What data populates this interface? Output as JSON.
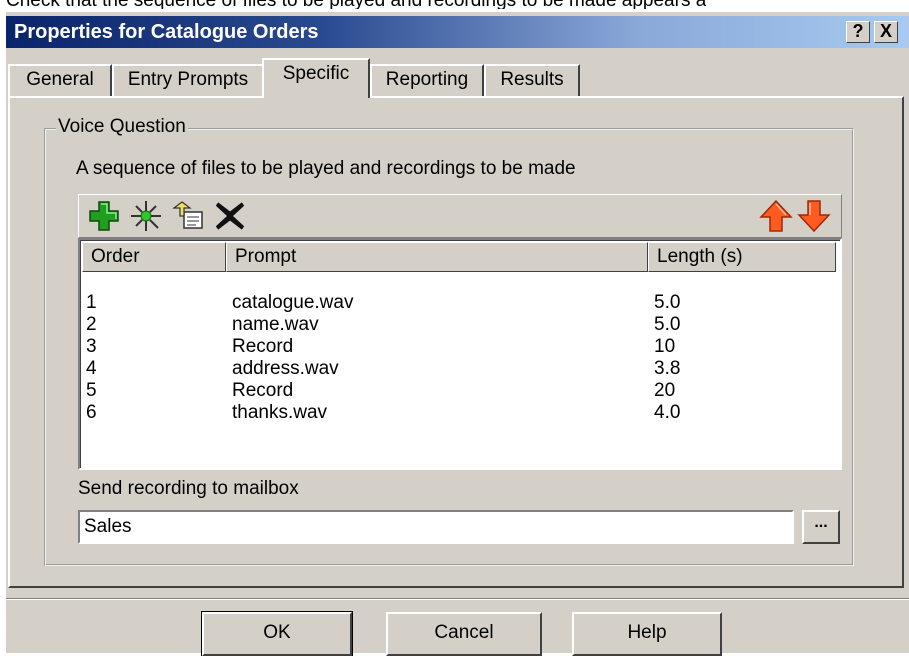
{
  "caption": "Check that the sequence of files to be played and recordings to be made appears a",
  "window": {
    "title": "Properties for Catalogue Orders",
    "help_btn": "?",
    "close_btn": "X"
  },
  "tabs": [
    {
      "label": "General"
    },
    {
      "label": "Entry Prompts"
    },
    {
      "label": "Specific"
    },
    {
      "label": "Reporting"
    },
    {
      "label": "Results"
    }
  ],
  "active_tab": "Specific",
  "group": {
    "title": "Voice Question",
    "description": "A sequence of files to be played and recordings to be made"
  },
  "toolbar": {
    "icons": [
      "add-icon",
      "new-recording-icon",
      "edit-prompt-icon",
      "delete-icon",
      "move-up-icon",
      "move-down-icon"
    ],
    "colors": {
      "add": "#1f9e1f",
      "move": "#ff5a1f"
    }
  },
  "table": {
    "columns": [
      "Order",
      "Prompt",
      "Length (s)"
    ],
    "rows": [
      [
        "1",
        "catalogue.wav",
        "5.0"
      ],
      [
        "2",
        "name.wav",
        "5.0"
      ],
      [
        "3",
        "Record",
        "10"
      ],
      [
        "4",
        "address.wav",
        "3.8"
      ],
      [
        "5",
        "Record",
        "20"
      ],
      [
        "6",
        "thanks.wav",
        "4.0"
      ]
    ]
  },
  "mailbox": {
    "label": "Send recording to mailbox",
    "value": "Sales",
    "browse_label": "..."
  },
  "buttons": {
    "ok": "OK",
    "cancel": "Cancel",
    "help": "Help"
  }
}
